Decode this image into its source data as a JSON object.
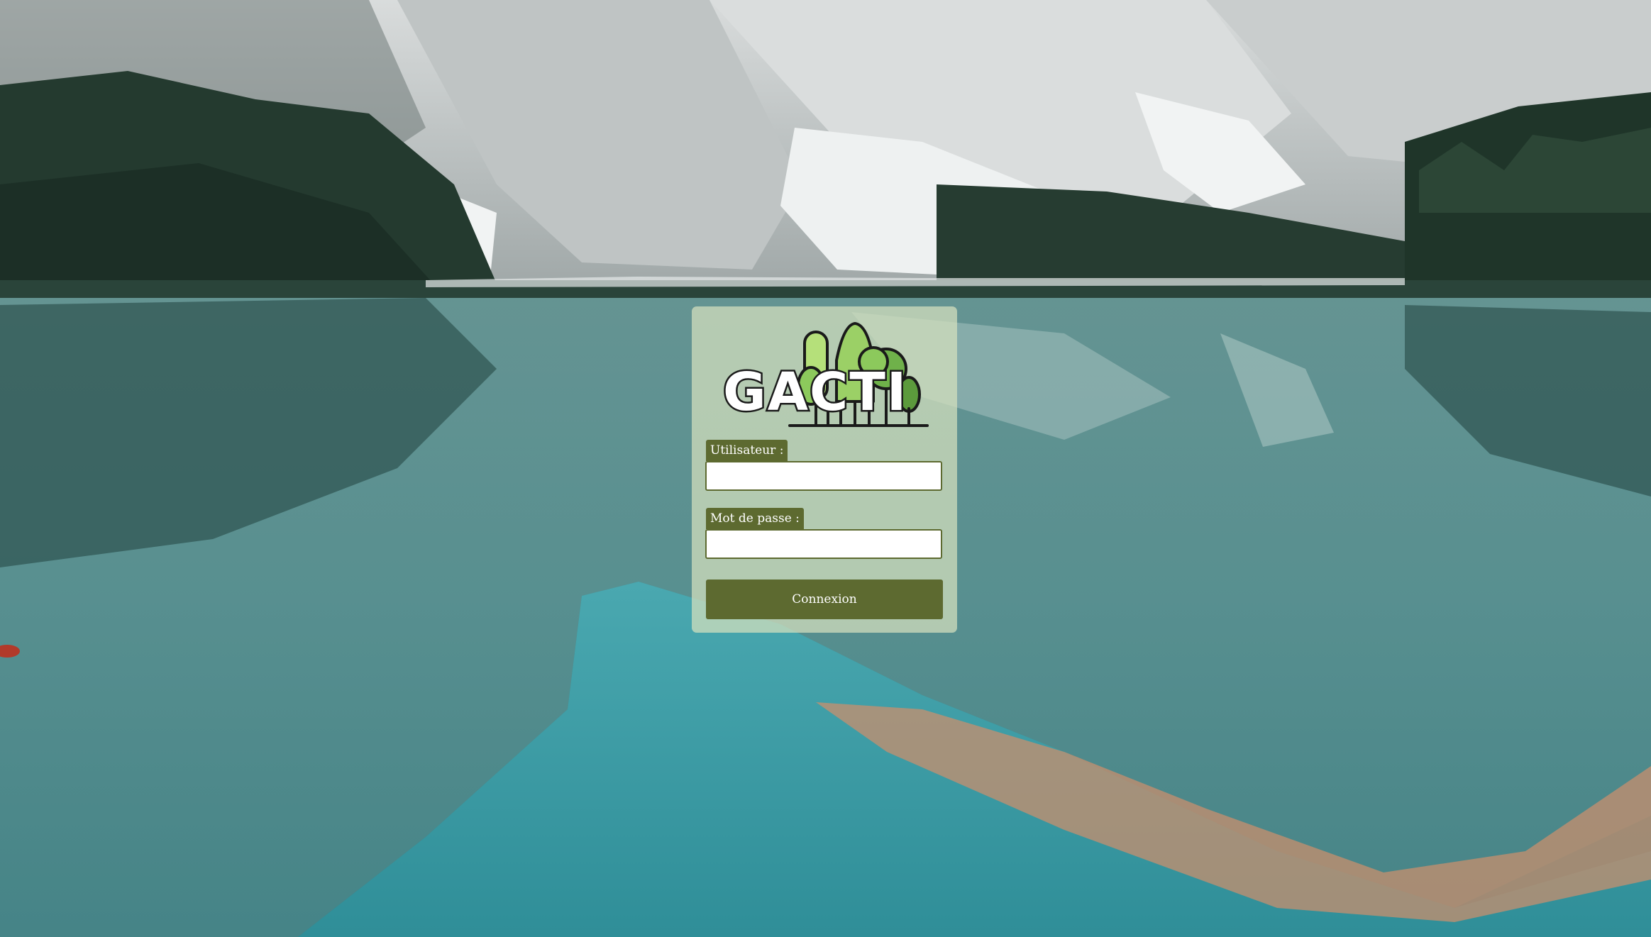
{
  "logo": {
    "text": "GACTI"
  },
  "form": {
    "username_label": "Utilisateur :",
    "username_value": "",
    "password_label": "Mot de passe :",
    "password_value": "",
    "submit_label": "Connexion"
  },
  "colors": {
    "accent": "#5d6a30",
    "panel_background": "#d6e0be",
    "tree_light": "#a8d66a",
    "tree_dark": "#5c9a3c"
  },
  "background": {
    "icon": "mountain-lake-photo"
  }
}
